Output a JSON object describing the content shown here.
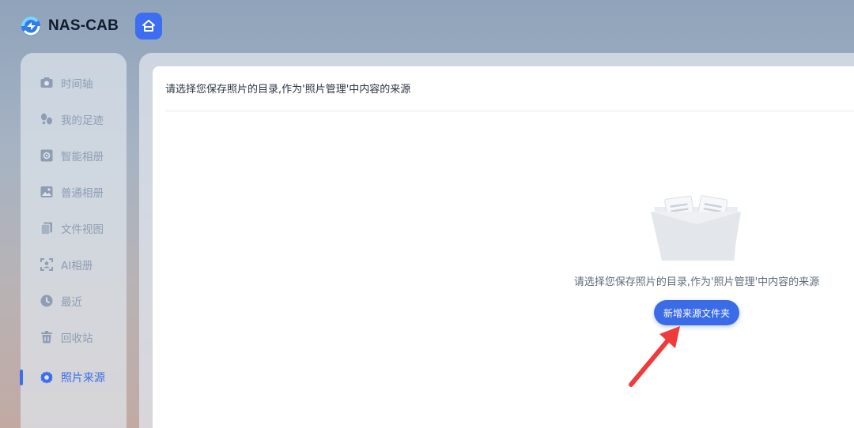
{
  "app": {
    "name": "NAS-CAB"
  },
  "header": {
    "home_icon": "home-icon"
  },
  "sidebar": {
    "items": [
      {
        "label": "时间轴",
        "icon": "camera-icon"
      },
      {
        "label": "我的足迹",
        "icon": "footprints-icon"
      },
      {
        "label": "智能相册",
        "icon": "smart-album-icon"
      },
      {
        "label": "普通相册",
        "icon": "image-icon"
      },
      {
        "label": "文件视图",
        "icon": "files-icon"
      },
      {
        "label": "AI相册",
        "icon": "face-scan-icon"
      },
      {
        "label": "最近",
        "icon": "clock-icon"
      },
      {
        "label": "回收站",
        "icon": "trash-icon"
      },
      {
        "label": "照片来源",
        "icon": "gear-icon",
        "active": true
      }
    ]
  },
  "main": {
    "title": "请选择您保存照片的目录,作为'照片管理'中内容的来源",
    "empty": {
      "icon": "empty-box-icon",
      "message": "请选择您保存照片的目录,作为'照片管理'中内容的来源",
      "button_label": "新增来源文件夹"
    }
  },
  "colors": {
    "accent": "#3d6df0",
    "annotation_arrow": "#ef3b3b"
  }
}
